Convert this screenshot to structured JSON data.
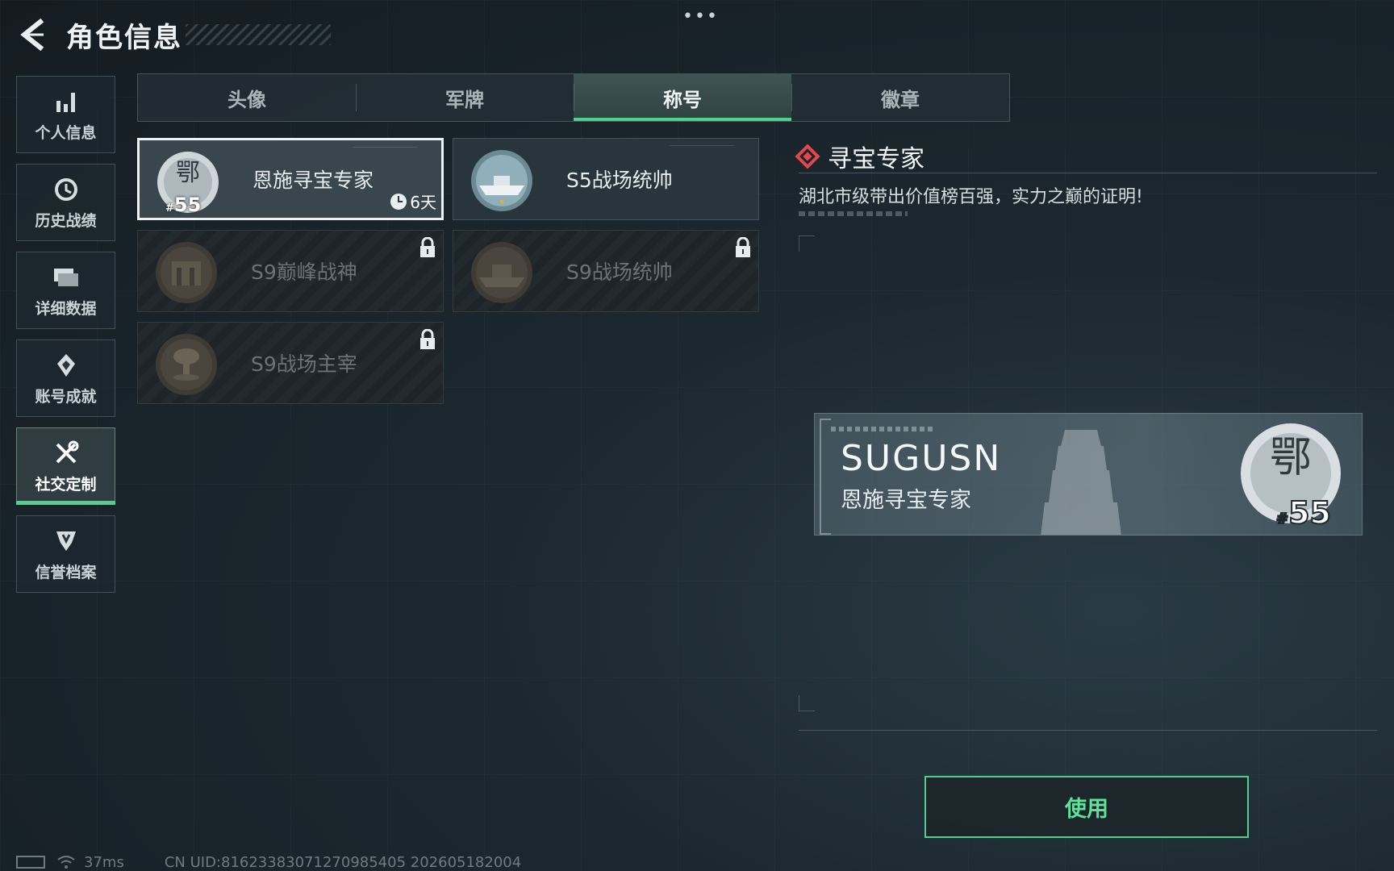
{
  "header": {
    "title": "角色信息",
    "back_icon": "arrow-left-icon",
    "more_icon": "more-dots-icon"
  },
  "side_nav": [
    {
      "label": "个人信息",
      "icon": "bar-chart-icon",
      "active": false
    },
    {
      "label": "历史战绩",
      "icon": "history-clock-icon",
      "active": false
    },
    {
      "label": "详细数据",
      "icon": "folder-icon",
      "active": false
    },
    {
      "label": "账号成就",
      "icon": "achievement-icon",
      "active": false
    },
    {
      "label": "社交定制",
      "icon": "tools-icon",
      "active": true
    },
    {
      "label": "信誉档案",
      "icon": "shield-icon",
      "active": false
    }
  ],
  "tabs": [
    {
      "label": "头像",
      "active": false
    },
    {
      "label": "军牌",
      "active": false
    },
    {
      "label": "称号",
      "active": true
    },
    {
      "label": "徽章",
      "active": false
    }
  ],
  "titles": [
    {
      "label": "恩施寻宝专家",
      "selected": true,
      "locked": false,
      "timer": "6天",
      "medal": "e-region-medal-icon",
      "rank": "55"
    },
    {
      "label": "S5战场统帅",
      "selected": false,
      "locked": false,
      "medal": "boat-medal-icon"
    },
    {
      "label": "S9巅峰战神",
      "selected": false,
      "locked": true,
      "medal": "building-medal-icon"
    },
    {
      "label": "S9战场统帅",
      "selected": false,
      "locked": true,
      "medal": "ship-medal-icon"
    },
    {
      "label": "S9战场主宰",
      "selected": false,
      "locked": true,
      "medal": "mushroom-cloud-medal-icon"
    }
  ],
  "detail": {
    "title": "寻宝专家",
    "description": "湖北市级带出价值榜百强，实力之巅的证明!",
    "accent_color": "#e0484d"
  },
  "preview": {
    "player_name": "SUGUSN",
    "title": "恩施寻宝专家",
    "rank": "55",
    "rank_prefix": "#"
  },
  "use_button": {
    "label": "使用",
    "color": "#4fd18b"
  },
  "status": {
    "ping": "37ms",
    "uid": "CN UID:8162338307127098540​5 202605182004"
  }
}
